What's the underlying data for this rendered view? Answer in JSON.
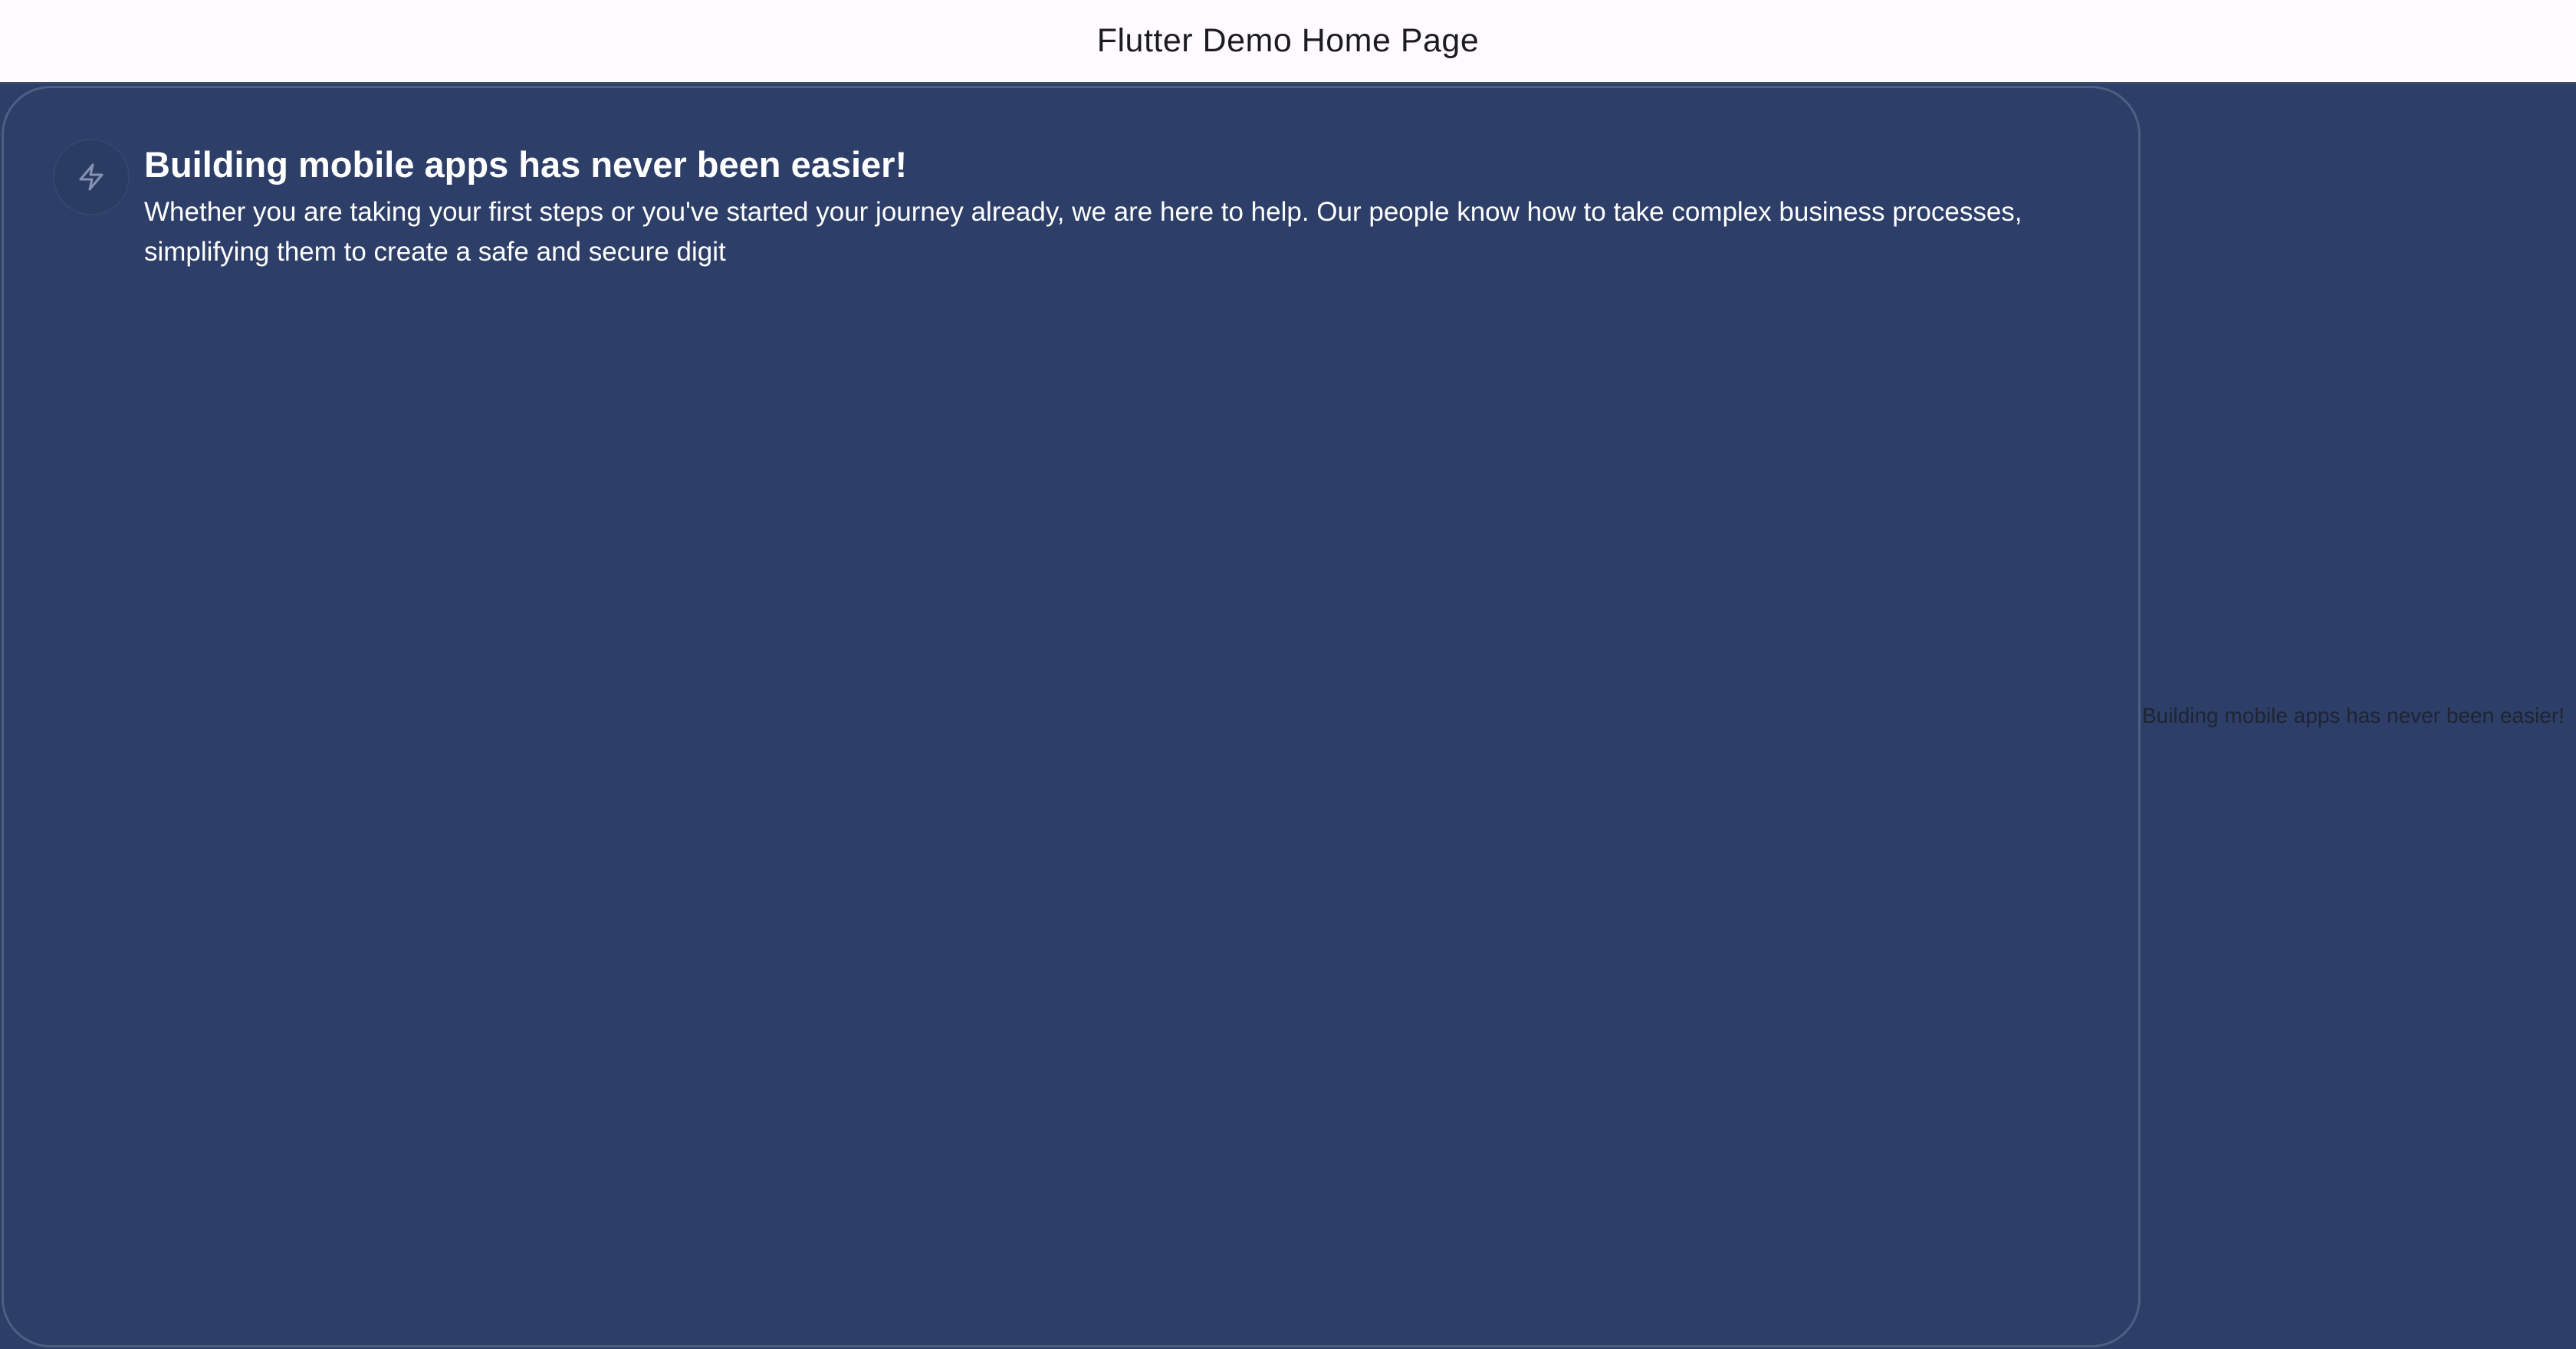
{
  "app_bar": {
    "title": "Flutter Demo Home Page"
  },
  "card": {
    "icon": "bolt-outline-icon",
    "title": "Building mobile apps has never been easier!",
    "body": "Whether you are taking your first steps or you've started your journey already, we are here to help. Our people know how to take complex business processes, simplifying them to create a safe and secure digit"
  },
  "side_label": {
    "text": "Building mobile apps has never been easier!"
  },
  "colors": {
    "background": "#2d3f68",
    "app_bar": "#fefbff",
    "card_border": "#4f5f82",
    "text_light": "#ffffff",
    "text_dark": "#1c1b1f"
  }
}
